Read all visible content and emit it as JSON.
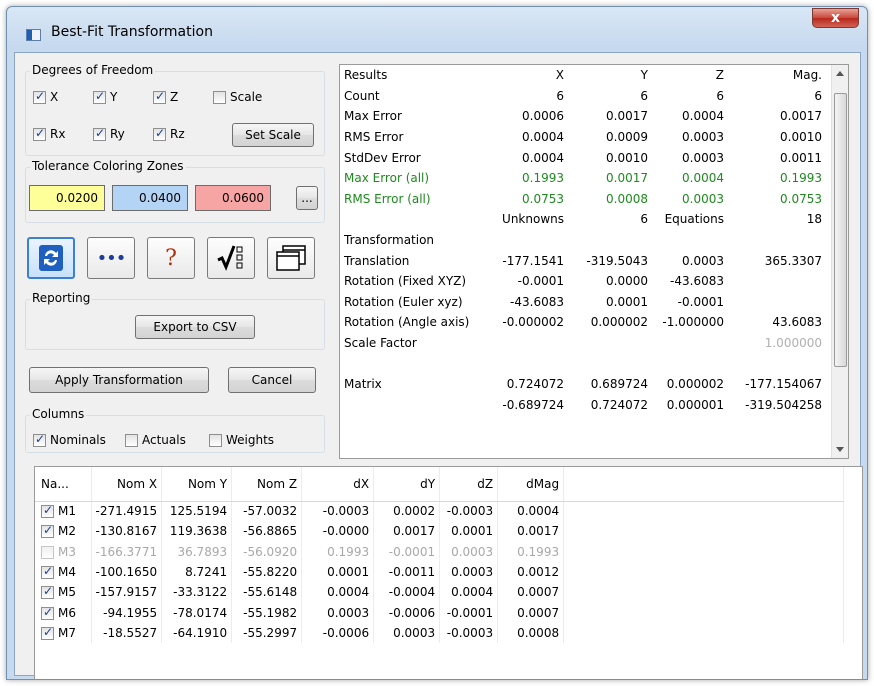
{
  "window": {
    "title": "Best-Fit Transformation",
    "close_glyph": "x"
  },
  "dof": {
    "label": "Degrees of Freedom",
    "items": [
      {
        "label": "X",
        "checked": true
      },
      {
        "label": "Y",
        "checked": true
      },
      {
        "label": "Z",
        "checked": true
      },
      {
        "label": "Scale",
        "checked": false
      },
      {
        "label": "Rx",
        "checked": true
      },
      {
        "label": "Ry",
        "checked": true
      },
      {
        "label": "Rz",
        "checked": true
      }
    ],
    "set_scale": "Set Scale"
  },
  "tolerance": {
    "label": "Tolerance Coloring Zones",
    "zones": [
      {
        "value": "0.0200",
        "color": "#ffff99"
      },
      {
        "value": "0.0400",
        "color": "#b4d4f5"
      },
      {
        "value": "0.0600",
        "color": "#f7a4a4"
      }
    ],
    "more": "..."
  },
  "toolbar": {
    "icons": [
      "refresh-icon",
      "more-options-icon",
      "help-icon",
      "checklist-icon",
      "windows-icon"
    ],
    "dots": "•••",
    "question": "?"
  },
  "reporting": {
    "label": "Reporting",
    "export": "Export to CSV"
  },
  "actions": {
    "apply": "Apply Transformation",
    "cancel": "Cancel"
  },
  "columns": {
    "label": "Columns",
    "items": [
      {
        "label": "Nominals",
        "checked": true
      },
      {
        "label": "Actuals",
        "checked": false
      },
      {
        "label": "Weights",
        "checked": false
      }
    ]
  },
  "results": {
    "headers": [
      "Results",
      "X",
      "Y",
      "Z",
      "Mag."
    ],
    "rows": [
      {
        "cells": [
          "Count",
          "6",
          "6",
          "6",
          "6"
        ],
        "style": ""
      },
      {
        "cells": [
          "Max Error",
          "0.0006",
          "0.0017",
          "0.0004",
          "0.0017"
        ],
        "style": ""
      },
      {
        "cells": [
          "RMS Error",
          "0.0004",
          "0.0009",
          "0.0003",
          "0.0010"
        ],
        "style": ""
      },
      {
        "cells": [
          "StdDev Error",
          "0.0004",
          "0.0010",
          "0.0003",
          "0.0011"
        ],
        "style": ""
      },
      {
        "cells": [
          "Max Error (all)",
          "0.1993",
          "0.0017",
          "0.0004",
          "0.1993"
        ],
        "style": "green"
      },
      {
        "cells": [
          "RMS Error (all)",
          "0.0753",
          "0.0008",
          "0.0003",
          "0.0753"
        ],
        "style": "green"
      },
      {
        "cells": [
          "",
          "Unknowns",
          "6",
          "Equations",
          "18"
        ],
        "style": ""
      },
      {
        "cells": [
          " Transformation",
          "",
          "",
          "",
          ""
        ],
        "style": ""
      },
      {
        "cells": [
          "Translation",
          "-177.1541",
          "-319.5043",
          "0.0003",
          "365.3307"
        ],
        "style": ""
      },
      {
        "cells": [
          "Rotation (Fixed XYZ)",
          "-0.0001",
          "0.0000",
          "-43.6083",
          ""
        ],
        "style": ""
      },
      {
        "cells": [
          "Rotation (Euler xyz)",
          "-43.6083",
          "0.0001",
          "-0.0001",
          ""
        ],
        "style": ""
      },
      {
        "cells": [
          "Rotation (Angle axis)",
          "-0.000002",
          "0.000002",
          "-1.000000",
          "43.6083"
        ],
        "style": ""
      },
      {
        "cells": [
          "Scale Factor",
          "",
          "",
          "",
          "1.000000"
        ],
        "style": "grayLast"
      },
      {
        "cells": [
          "",
          "",
          "",
          "",
          ""
        ],
        "style": ""
      },
      {
        "cells": [
          " Matrix",
          "0.724072",
          "0.689724",
          "0.000002",
          "-177.154067"
        ],
        "style": ""
      },
      {
        "cells": [
          "",
          "-0.689724",
          "0.724072",
          "0.000001",
          "-319.504258"
        ],
        "style": ""
      }
    ]
  },
  "points": {
    "headers": [
      "Na...",
      "Nom X",
      "Nom Y",
      "Nom Z",
      "dX",
      "dY",
      "dZ",
      "dMag"
    ],
    "rows": [
      {
        "checked": true,
        "cells": [
          "M1",
          "-271.4915",
          "125.5194",
          "-57.0032",
          "-0.0003",
          "0.0002",
          "-0.0003",
          "0.0004"
        ]
      },
      {
        "checked": true,
        "cells": [
          "M2",
          "-130.8167",
          "119.3638",
          "-56.8865",
          "-0.0000",
          "0.0017",
          "0.0001",
          "0.0017"
        ]
      },
      {
        "checked": false,
        "cells": [
          "M3",
          "-166.3771",
          "36.7893",
          "-56.0920",
          "0.1993",
          "-0.0001",
          "0.0003",
          "0.1993"
        ]
      },
      {
        "checked": true,
        "cells": [
          "M4",
          "-100.1650",
          "8.7241",
          "-55.8220",
          "0.0001",
          "-0.0011",
          "0.0003",
          "0.0012"
        ]
      },
      {
        "checked": true,
        "cells": [
          "M5",
          "-157.9157",
          "-33.3122",
          "-55.6148",
          "0.0004",
          "-0.0004",
          "0.0004",
          "0.0007"
        ]
      },
      {
        "checked": true,
        "cells": [
          "M6",
          "-94.1955",
          "-78.0174",
          "-55.1982",
          "0.0003",
          "-0.0006",
          "-0.0001",
          "0.0007"
        ]
      },
      {
        "checked": true,
        "cells": [
          "M7",
          "-18.5527",
          "-64.1910",
          "-55.2997",
          "-0.0006",
          "0.0003",
          "-0.0003",
          "0.0008"
        ]
      }
    ]
  },
  "colors": {
    "green_text": "#1e8a1e",
    "accent": "#1d5fb0"
  }
}
